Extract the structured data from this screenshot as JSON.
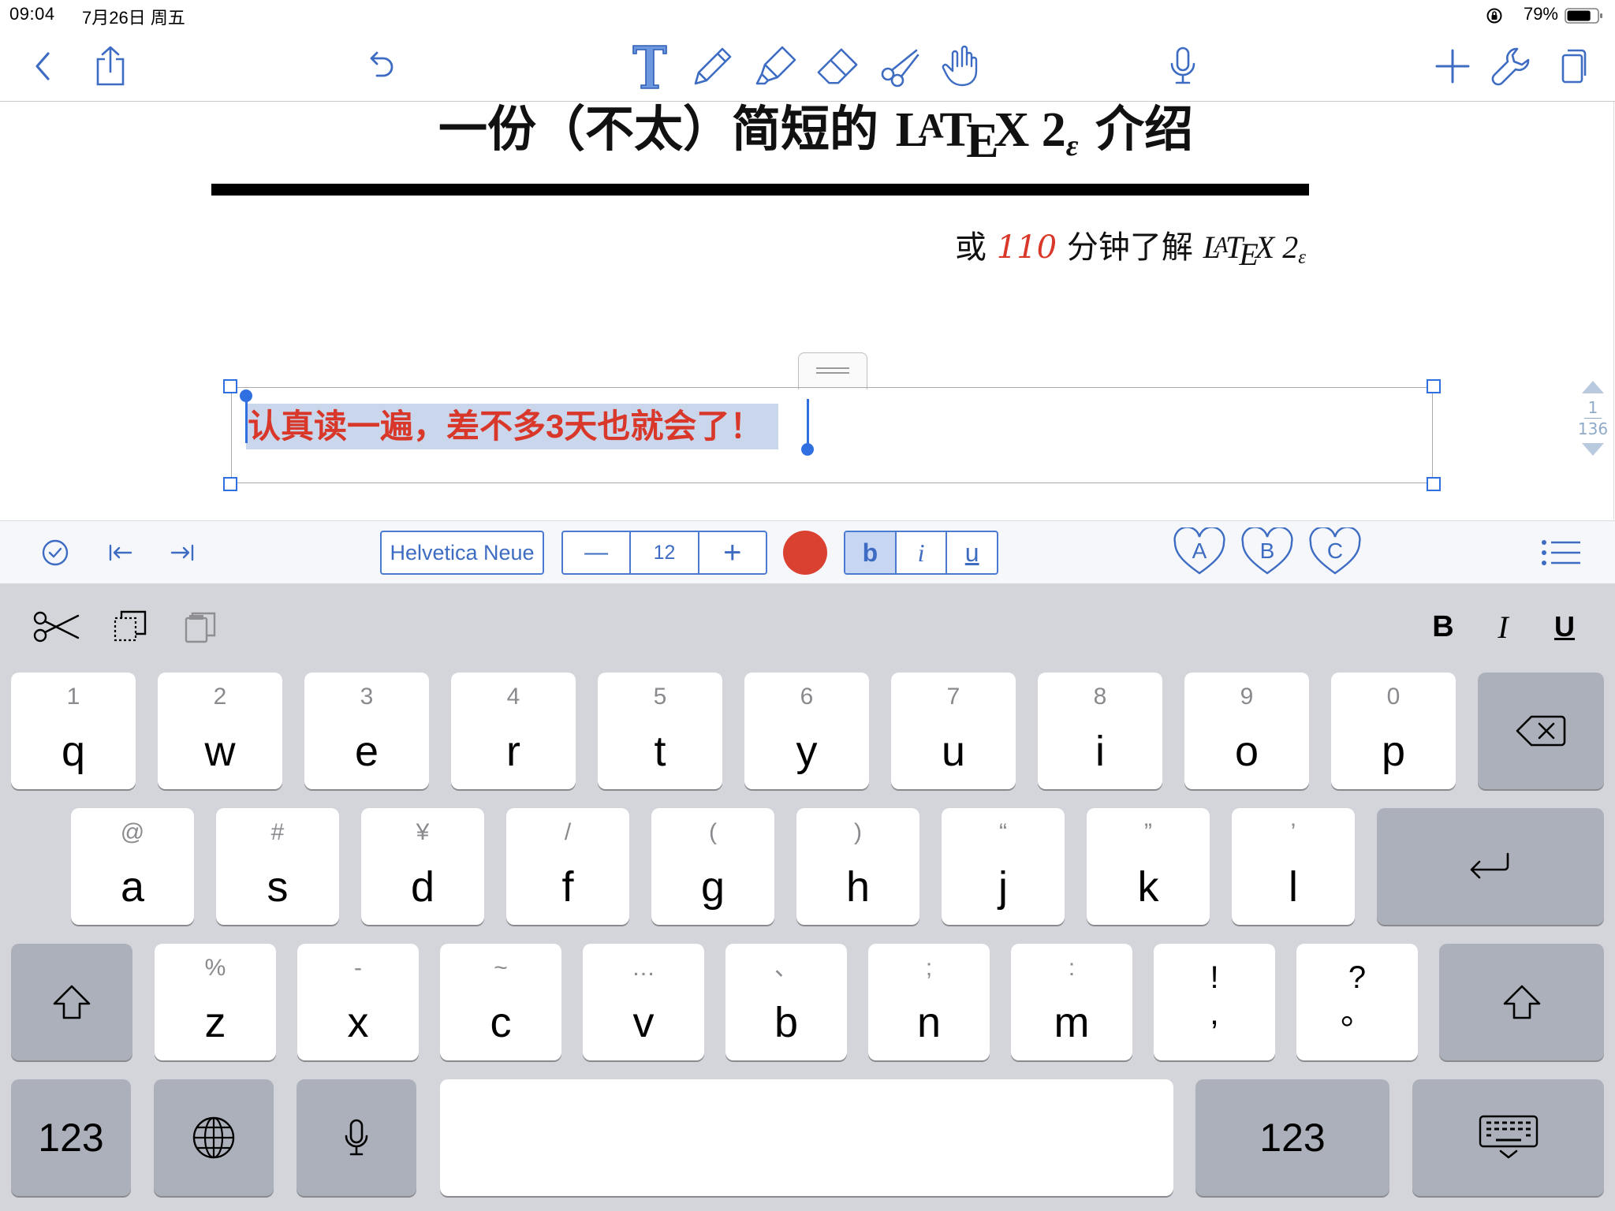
{
  "status_bar": {
    "time": "09:04",
    "date": "7月26日 周五",
    "battery_percent": "79%",
    "battery_level": 0.79
  },
  "toolbar": {
    "left": [
      "back-icon",
      "share-icon",
      "undo-icon"
    ],
    "tools": [
      "text-tool-icon",
      "pen-icon",
      "highlighter-icon",
      "eraser-icon",
      "scissors-icon",
      "hand-pointer-icon"
    ],
    "center": [
      "microphone-icon"
    ],
    "right": [
      "add-icon",
      "wrench-icon",
      "pages-icon"
    ],
    "accent_color": "#3d6cc2"
  },
  "document": {
    "title_prefix": "一份（不太）简短的 ",
    "title_suffix": " 介绍",
    "subtitle_prefix": "或 ",
    "subtitle_number": "110",
    "subtitle_middle": " 分钟了解 ",
    "latex_L": "L",
    "latex_A": "A",
    "latex_T": "T",
    "latex_E": "E",
    "latex_X": "X",
    "latex_2": " 2",
    "latex_epsilon": "ε",
    "textbox_text": "认真读一遍，差不多3天也就会了！",
    "text_color": "#d8372a",
    "page_current": "1",
    "page_total": "136"
  },
  "format_bar": {
    "font_name": "Helvetica Neue",
    "font_size": "12",
    "minus_label": "—",
    "plus_label": "+",
    "color": "#db4130",
    "bold_label": "b",
    "italic_label": "i",
    "underline_label": "u",
    "favorites": [
      "A",
      "B",
      "C"
    ]
  },
  "keyboard": {
    "shortcut_bold": "B",
    "shortcut_italic": "I",
    "shortcut_underline": "U",
    "row1": [
      {
        "hint": "1",
        "main": "q"
      },
      {
        "hint": "2",
        "main": "w"
      },
      {
        "hint": "3",
        "main": "e"
      },
      {
        "hint": "4",
        "main": "r"
      },
      {
        "hint": "5",
        "main": "t"
      },
      {
        "hint": "6",
        "main": "y"
      },
      {
        "hint": "7",
        "main": "u"
      },
      {
        "hint": "8",
        "main": "i"
      },
      {
        "hint": "9",
        "main": "o"
      },
      {
        "hint": "0",
        "main": "p"
      }
    ],
    "row2": [
      {
        "hint": "@",
        "main": "a"
      },
      {
        "hint": "#",
        "main": "s"
      },
      {
        "hint": "¥",
        "main": "d"
      },
      {
        "hint": "/",
        "main": "f"
      },
      {
        "hint": "(",
        "main": "g"
      },
      {
        "hint": ")",
        "main": "h"
      },
      {
        "hint": "“",
        "main": "j"
      },
      {
        "hint": "”",
        "main": "k"
      },
      {
        "hint": "’",
        "main": "l"
      }
    ],
    "row3": [
      {
        "hint": "%",
        "main": "z"
      },
      {
        "hint": "-",
        "main": "x"
      },
      {
        "hint": "~",
        "main": "c"
      },
      {
        "hint": "…",
        "main": "v"
      },
      {
        "hint": "、",
        "main": "b"
      },
      {
        "hint": ";",
        "main": "n"
      },
      {
        "hint": ":",
        "main": "m"
      }
    ],
    "punct1_top": "!",
    "punct1_bottom": ",",
    "punct2_top": "?",
    "punct2_bottom": "。",
    "numbers_label": "123",
    "space_label": ""
  }
}
